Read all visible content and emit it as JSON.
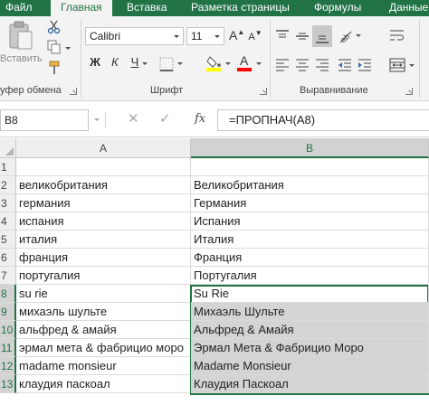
{
  "ribbon": {
    "tabs": [
      "Файл",
      "Главная",
      "Вставка",
      "Разметка страницы",
      "Формулы",
      "Данные"
    ],
    "clipboard": {
      "paste_label": "Вставить",
      "group_label": "уфер обмена"
    },
    "font": {
      "name": "Calibri",
      "size": "11",
      "increase_label": "A",
      "decrease_label": "A",
      "bold_label": "Ж",
      "italic_label": "К",
      "underline_label": "Ч",
      "fill_color": "#ffff00",
      "font_color": "#ff0000",
      "group_label": "Шрифт"
    },
    "alignment": {
      "group_label": "Выравнивание"
    }
  },
  "formula_bar": {
    "name_box": "B8",
    "cancel_icon": "✕",
    "enter_icon": "✓",
    "fx_label": "fx",
    "formula": "=ПРОПНАЧ(A8)"
  },
  "sheet": {
    "columns": [
      "A",
      "B"
    ],
    "rows": [
      {
        "num": "1",
        "a": "",
        "b": ""
      },
      {
        "num": "2",
        "a": "великобритания",
        "b": "Великобритания"
      },
      {
        "num": "3",
        "a": "германия",
        "b": "Германия"
      },
      {
        "num": "4",
        "a": "испания",
        "b": "Испания"
      },
      {
        "num": "5",
        "a": "италия",
        "b": "Италия"
      },
      {
        "num": "6",
        "a": "франция",
        "b": "Франция"
      },
      {
        "num": "7",
        "a": "португалия",
        "b": "Португалия"
      },
      {
        "num": "8",
        "a": "su rie",
        "b": "Su Rie"
      },
      {
        "num": "9",
        "a": "михаэль шульте",
        "b": "Михаэль Шульте"
      },
      {
        "num": "10",
        "a": "альфред & амайя",
        "b": "Альфред & Амайя"
      },
      {
        "num": "11",
        "a": "эрмал мета & фабрицио моро",
        "b": "Эрмал Мета & Фабрицио Моро"
      },
      {
        "num": "12",
        "a": "madame monsieur",
        "b": "Madame Monsieur"
      },
      {
        "num": "13",
        "a": "клаудия паскоал",
        "b": "Клаудия Паскоал"
      }
    ]
  },
  "colors": {
    "accent": "#217346",
    "selection_fill": "#d4d4d4",
    "header_fill": "#efefef"
  }
}
